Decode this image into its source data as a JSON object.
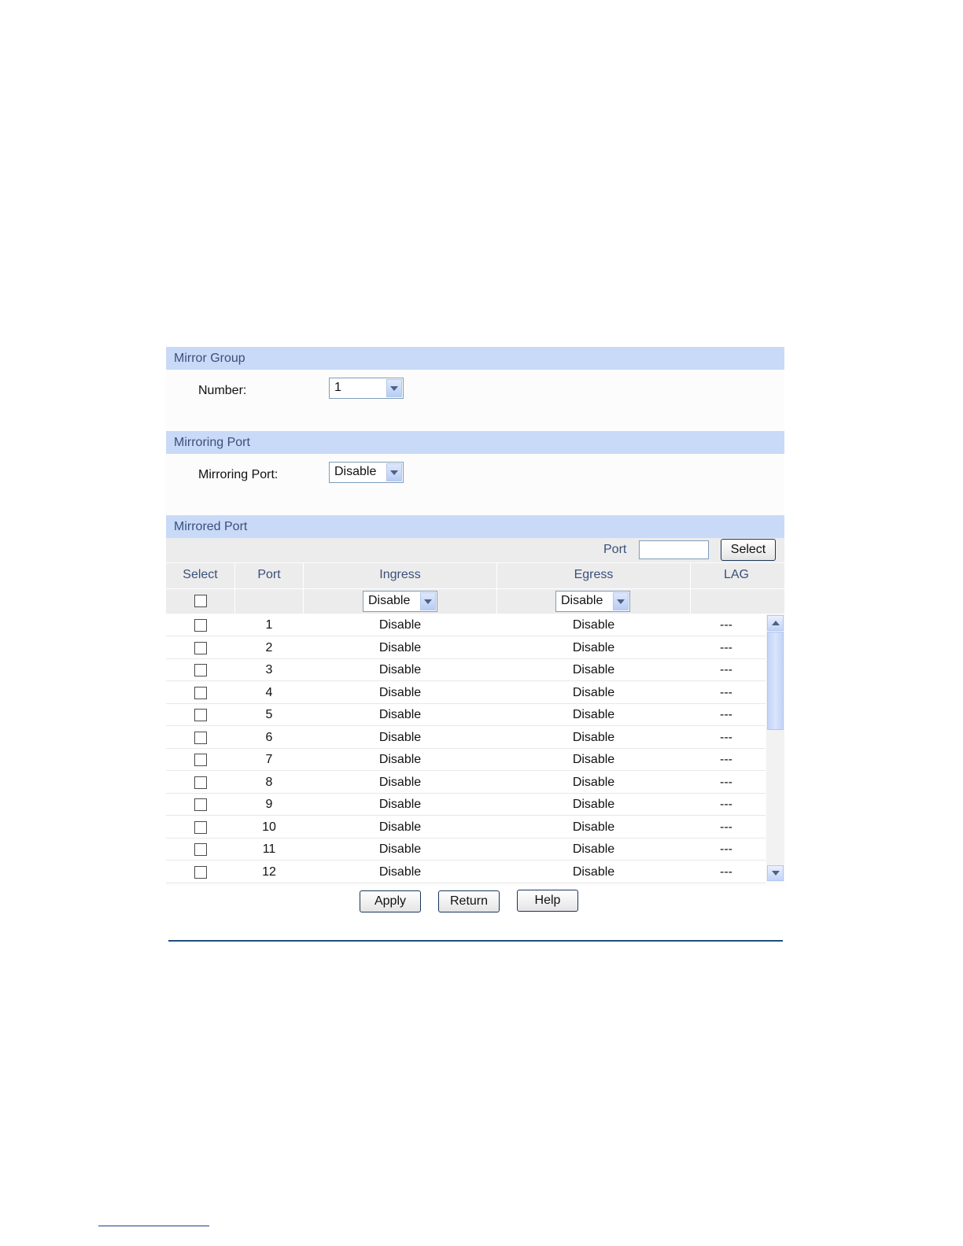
{
  "mirror_group": {
    "title": "Mirror Group",
    "number_label": "Number:",
    "number_value": "1"
  },
  "mirroring_port": {
    "title": "Mirroring Port",
    "port_label": "Mirroring Port:",
    "port_value": "Disable"
  },
  "mirrored_port": {
    "title": "Mirrored Port",
    "port_filter_label": "Port",
    "port_filter_value": "",
    "select_button": "Select",
    "columns": {
      "select": "Select",
      "port": "Port",
      "ingress": "Ingress",
      "egress": "Egress",
      "lag": "LAG"
    },
    "ingress_all": "Disable",
    "egress_all": "Disable",
    "rows": [
      {
        "port": "1",
        "ingress": "Disable",
        "egress": "Disable",
        "lag": "---"
      },
      {
        "port": "2",
        "ingress": "Disable",
        "egress": "Disable",
        "lag": "---"
      },
      {
        "port": "3",
        "ingress": "Disable",
        "egress": "Disable",
        "lag": "---"
      },
      {
        "port": "4",
        "ingress": "Disable",
        "egress": "Disable",
        "lag": "---"
      },
      {
        "port": "5",
        "ingress": "Disable",
        "egress": "Disable",
        "lag": "---"
      },
      {
        "port": "6",
        "ingress": "Disable",
        "egress": "Disable",
        "lag": "---"
      },
      {
        "port": "7",
        "ingress": "Disable",
        "egress": "Disable",
        "lag": "---"
      },
      {
        "port": "8",
        "ingress": "Disable",
        "egress": "Disable",
        "lag": "---"
      },
      {
        "port": "9",
        "ingress": "Disable",
        "egress": "Disable",
        "lag": "---"
      },
      {
        "port": "10",
        "ingress": "Disable",
        "egress": "Disable",
        "lag": "---"
      },
      {
        "port": "11",
        "ingress": "Disable",
        "egress": "Disable",
        "lag": "---"
      },
      {
        "port": "12",
        "ingress": "Disable",
        "egress": "Disable",
        "lag": "---"
      }
    ]
  },
  "actions": {
    "apply": "Apply",
    "return": "Return",
    "help": "Help"
  },
  "colors": {
    "section_header_bg": "#c9daf8",
    "section_header_text": "#3a4f7a",
    "table_header_bg": "#ececec",
    "rule": "#1f4e7a"
  }
}
